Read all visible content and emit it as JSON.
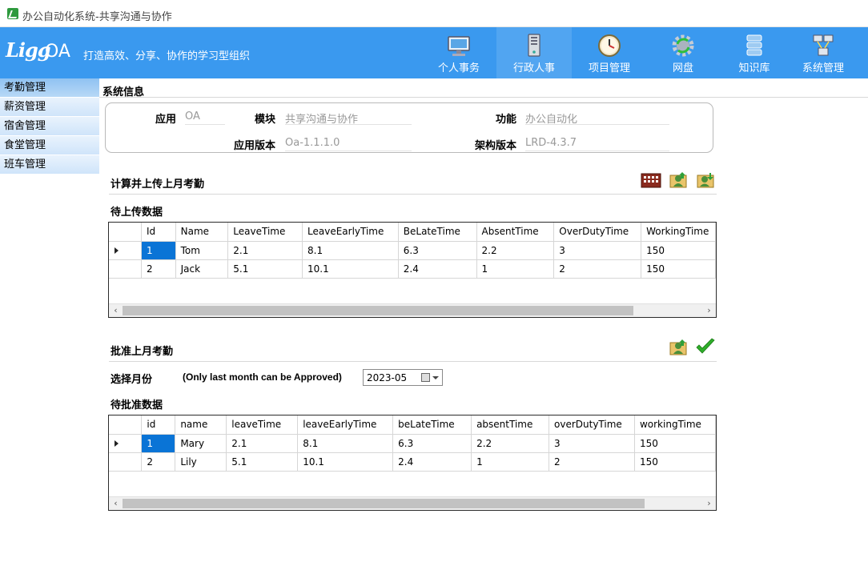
{
  "window": {
    "title": "办公自动化系统-共享沟通与协作"
  },
  "header": {
    "brand": "Ligg",
    "brand_suffix": "OA",
    "slogan": "打造高效、分享、协作的学习型组织",
    "nav": [
      {
        "label": "个人事务",
        "icon": "monitor-icon"
      },
      {
        "label": "行政人事",
        "icon": "server-icon"
      },
      {
        "label": "项目管理",
        "icon": "clock-icon"
      },
      {
        "label": "网盘",
        "icon": "gear-refresh-icon"
      },
      {
        "label": "知识库",
        "icon": "database-icon"
      },
      {
        "label": "系统管理",
        "icon": "network-icon"
      }
    ]
  },
  "sidebar": {
    "items": [
      {
        "label": "考勤管理"
      },
      {
        "label": "薪资管理"
      },
      {
        "label": "宿舍管理"
      },
      {
        "label": "食堂管理"
      },
      {
        "label": "班车管理"
      }
    ]
  },
  "system_info": {
    "title": "系统信息",
    "app_label": "应用",
    "app_value": "OA",
    "module_label": "模块",
    "module_value": "共享沟通与协作",
    "function_label": "功能",
    "function_value": "办公自动化",
    "app_version_label": "应用版本",
    "app_version_value": "Oa-1.1.1.0",
    "arch_version_label": "架构版本",
    "arch_version_value": "LRD-4.3.7"
  },
  "upload": {
    "title": "计算并上传上月考勤",
    "subtitle": "待上传数据",
    "columns": [
      "Id",
      "Name",
      "LeaveTime",
      "LeaveEarlyTime",
      "BeLateTime",
      "AbsentTime",
      "OverDutyTime",
      "WorkingTime"
    ],
    "rows": [
      [
        "1",
        "Tom",
        "2.1",
        "8.1",
        "6.3",
        "2.2",
        "3",
        "150"
      ],
      [
        "2",
        "Jack",
        "5.1",
        "10.1",
        "2.4",
        "1",
        "2",
        "150"
      ]
    ]
  },
  "approve": {
    "title": "批准上月考勤",
    "month_label": "选择月份",
    "month_note": "(Only last month can be Approved)",
    "month_value": "2023-05",
    "subtitle": "待批准数据",
    "columns": [
      "id",
      "name",
      "leaveTime",
      "leaveEarlyTime",
      "beLateTime",
      "absentTime",
      "overDutyTime",
      "workingTime"
    ],
    "rows": [
      [
        "1",
        "Mary",
        "2.1",
        "8.1",
        "6.3",
        "2.2",
        "3",
        "150"
      ],
      [
        "2",
        "Lily",
        "5.1",
        "10.1",
        "2.4",
        "1",
        "2",
        "150"
      ]
    ]
  }
}
